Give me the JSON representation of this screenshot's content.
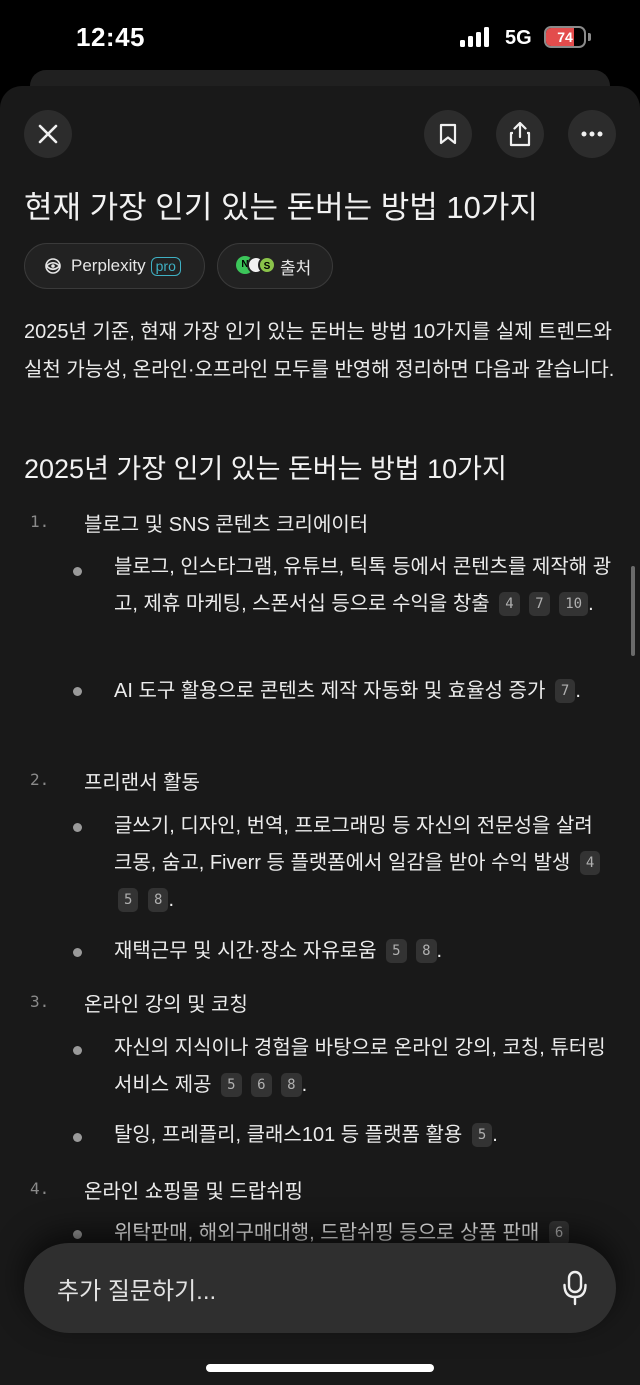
{
  "status_bar": {
    "time": "12:45",
    "network": "5G",
    "battery": "74",
    "battery_fill": 0.74
  },
  "toolbar": {
    "close_icon": "close-icon",
    "bookmark_icon": "bookmark-icon",
    "share_icon": "share-icon",
    "more_icon": "more-horizontal-icon"
  },
  "title": "현재 가장 인기 있는 돈버는 방법 10가지",
  "chips": {
    "perplexity_label": "Perplexity",
    "pro_label": "pro",
    "sources_label": "출처"
  },
  "intro": "2025년 기준, 현재 가장 인기 있는 돈버는 방법 10가지를 실제 트렌드와 실천 가능성, 온라인·오프라인 모두를 반영해 정리하면 다음과 같습니다.",
  "section_heading": "2025년 가장 인기 있는 돈버는 방법 10가지",
  "items": [
    {
      "num": "1.",
      "title": "블로그 및 SNS 콘텐츠 크리에이터",
      "bullets": [
        {
          "text": "블로그, 인스타그램, 유튜브, 틱톡 등에서 콘텐츠를 제작해 광고, 제휴 마케팅, 스폰서십 등으로 수익을 창출",
          "cites": [
            "4",
            "7",
            "10"
          ]
        },
        {
          "text": "AI 도구 활용으로 콘텐츠 제작 자동화 및 효율성 증가",
          "cites": [
            "7"
          ]
        }
      ]
    },
    {
      "num": "2.",
      "title": "프리랜서 활동",
      "bullets": [
        {
          "text": "글쓰기, 디자인, 번역, 프로그래밍 등 자신의 전문성을 살려 크몽, 숨고, Fiverr 등 플랫폼에서 일감을 받아 수익 발생",
          "cites": [
            "4",
            "5",
            "8"
          ]
        },
        {
          "text": "재택근무 및 시간·장소 자유로움",
          "cites": [
            "5",
            "8"
          ]
        }
      ]
    },
    {
      "num": "3.",
      "title": "온라인 강의 및 코칭",
      "bullets": [
        {
          "text": "자신의 지식이나 경험을 바탕으로 온라인 강의, 코칭, 튜터링 서비스 제공",
          "cites": [
            "5",
            "6",
            "8"
          ]
        },
        {
          "text": "탈잉, 프레플리, 클래스101 등 플랫폼 활용",
          "cites": [
            "5"
          ]
        }
      ]
    },
    {
      "num": "4.",
      "title": "온라인 쇼핑몰 및 드랍쉬핑",
      "bullets": [
        {
          "text": "위탁판매, 해외구매대행, 드랍쉬핑 등으로 상품 판매",
          "cites": [
            "6"
          ]
        }
      ]
    }
  ],
  "ask": {
    "placeholder": "추가 질문하기...",
    "mic_icon": "microphone-icon"
  },
  "colors": {
    "background": "#191919",
    "accent": "#3fb0c3",
    "battery_low": "#e34c4c"
  }
}
